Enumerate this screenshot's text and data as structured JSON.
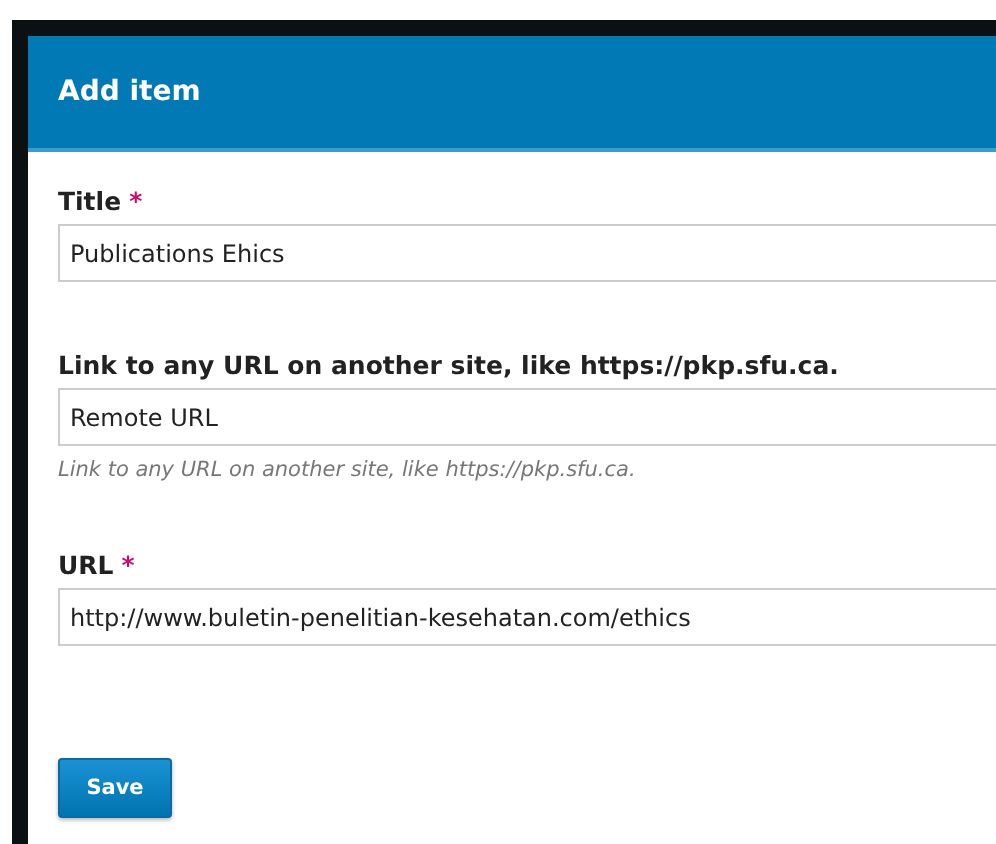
{
  "dialog": {
    "title": "Add item"
  },
  "fields": [
    {
      "label": "Title",
      "required_mark": "*",
      "value": "Publications Ehics"
    },
    {
      "label": "Link to any URL on another site, like https://pkp.sfu.ca.",
      "value": "Remote URL",
      "description": "Link to any URL on another site, like https://pkp.sfu.ca."
    },
    {
      "label": "URL",
      "required_mark": "*",
      "value": "http://www.buletin-penelitian-kesehatan.com/ethics"
    }
  ],
  "buttons": [
    {
      "label": "Save"
    }
  ]
}
